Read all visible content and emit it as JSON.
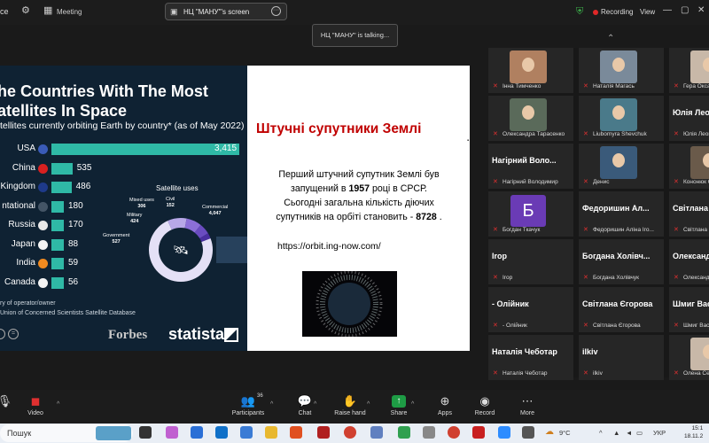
{
  "topbar": {
    "app_title": "ce",
    "meeting_label": "Meeting",
    "screen_share_label": "НЦ \"МАНУ\"'s screen",
    "recording_label": "Recording",
    "view_label": "View"
  },
  "talking_banner": "НЦ \"МАНУ\" is talking...",
  "slide": {
    "chart": {
      "title_line1": "he Countries With The Most",
      "title_line2": "atellites In Space",
      "subtitle": "tellites currently orbiting Earth by country* (as of May 2022)",
      "donut_title": "Satellite uses",
      "footnote1": "ry of operator/owner",
      "footnote2": "Union of Concerned Scientists Satellite Database",
      "forbes": "Forbes",
      "statista": "statista"
    },
    "slide_title": "Штучні  супутники Землі",
    "text_line1": "Перший штучний супутник Землі був",
    "text_line2a": "запущений в ",
    "text_line2b": "1957",
    "text_line2c": " році в СРСР.",
    "text_line3": "Сьогодні загальна кількість діючих",
    "text_line4a": "супутників на орбіті становить -  ",
    "text_line4b": "8728",
    "text_line4c": " .",
    "url": "https://orbit.ing-now.com/"
  },
  "chart_data": [
    {
      "type": "bar",
      "title": "he Countries With The Most atellites In Space",
      "categories": [
        "USA",
        "China",
        "Kingdom",
        "ntational",
        "Russia",
        "Japan",
        "India",
        "Canada"
      ],
      "values": [
        3415,
        535,
        486,
        180,
        170,
        88,
        59,
        56
      ],
      "value_labels": [
        "3,415",
        "535",
        "486",
        "180",
        "170",
        "88",
        "59",
        "56"
      ]
    },
    {
      "type": "pie",
      "title": "Satellite uses",
      "categories": [
        "Commercial",
        "Government",
        "Military",
        "Mixed uses",
        "Civil"
      ],
      "values": [
        4047,
        527,
        424,
        306,
        152
      ],
      "value_labels": [
        "4,047",
        "527",
        "424",
        "306",
        "152"
      ]
    }
  ],
  "gallery": {
    "participants": [
      {
        "small": "Інна Тимченко"
      },
      {
        "small": "Наталія Магась"
      },
      {
        "small": "Гера Оксана Гн"
      },
      {
        "small": "Олександра Тарасенко"
      },
      {
        "small": "Liubomyra Shevchuk"
      },
      {
        "big": "Юлія Леоне",
        "small": "Юлія Леоненко"
      },
      {
        "big": "Нагірний Воло...",
        "small": "Нагірний Володимир"
      },
      {
        "small": "Денис"
      },
      {
        "small": "Кононюк Олена"
      },
      {
        "letter": "Б",
        "small": "Богдан Ткачук"
      },
      {
        "big": "Федоришин  Ал...",
        "small": "Федоришин Аліна Іго..."
      },
      {
        "big": "Світлана Єгор",
        "small": "Світлана Єгорова"
      },
      {
        "big": "Irop",
        "small": "Irop"
      },
      {
        "big": "Богдана Холівч...",
        "small": "Богдана Холівчук"
      },
      {
        "big": "Олександр Щ",
        "small": "Олександр Ще"
      },
      {
        "big": "- Олійник",
        "small": "- Олійник"
      },
      {
        "big": "Світлана Єгорова",
        "small": "Світлана Єгорова"
      },
      {
        "big": "Шмиг Васи",
        "small": "Шмиг Василь"
      },
      {
        "big": "Наталія Чеботар",
        "small": "Наталія Чеботар"
      },
      {
        "big": "ilkiv",
        "small": "ilkiv"
      },
      {
        "small": "Олена Семене"
      }
    ]
  },
  "toolbar": {
    "video_label": "Video",
    "participants_label": "Participants",
    "participants_count": "36",
    "chat_label": "Chat",
    "raise_hand_label": "Raise hand",
    "share_label": "Share",
    "apps_label": "Apps",
    "record_label": "Record",
    "more_label": "More"
  },
  "taskbar": {
    "search_label": "Пошук",
    "weather": "9°C",
    "lang": "УКР",
    "time": "15:1",
    "date": "18.11.2"
  }
}
